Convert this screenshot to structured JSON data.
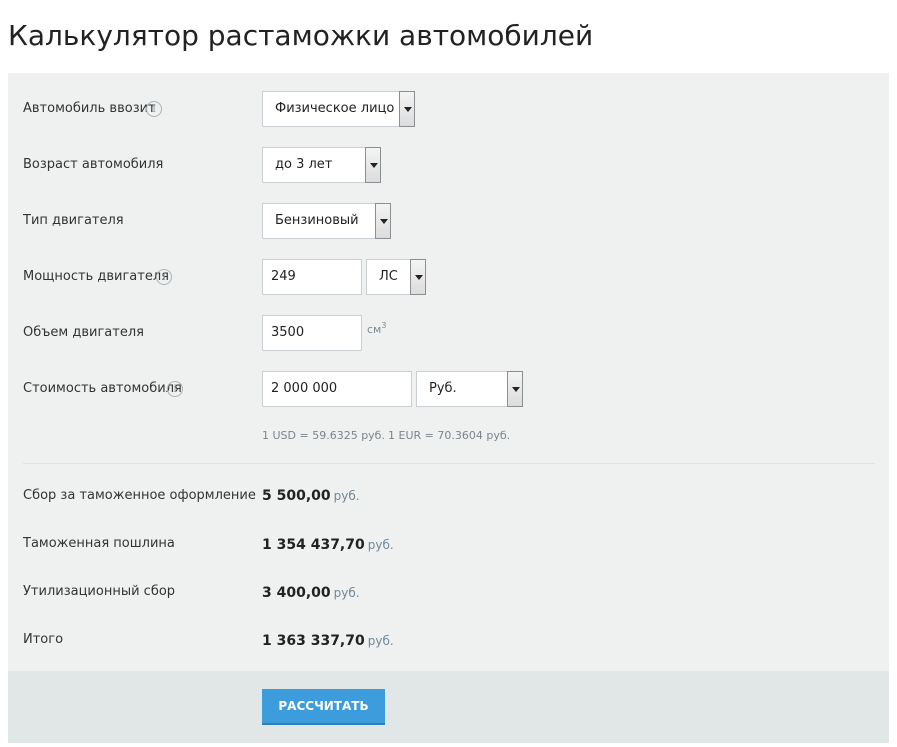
{
  "page": {
    "title": "Калькулятор растаможки автомобилей"
  },
  "form": {
    "importer": {
      "label": "Автомобиль ввозит",
      "value": "Физическое лицо"
    },
    "age": {
      "label": "Возраст автомобиля",
      "value": "до 3 лет"
    },
    "engine_type": {
      "label": "Тип двигателя",
      "value": "Бензиновый"
    },
    "power": {
      "label": "Мощность двигателя",
      "value": "249",
      "unit": "ЛС"
    },
    "volume": {
      "label": "Объем двигателя",
      "value": "3500",
      "unit": "см",
      "unit_exp": "3"
    },
    "cost": {
      "label": "Стоимость автомобиля",
      "value": "2 000 000",
      "currency": "Руб."
    },
    "info_glyph": "i"
  },
  "rates": {
    "usd": "1 USD = 59.6325 руб.",
    "eur": "1 EUR = 70.3604 руб."
  },
  "results": {
    "currency": "руб.",
    "items": [
      {
        "label": "Сбор за таможенное оформление",
        "value": "5 500,00"
      },
      {
        "label": "Таможенная пошлина",
        "value": "1 354 437,70"
      },
      {
        "label": "Утилизационный сбор",
        "value": "3 400,00"
      },
      {
        "label": "Итого",
        "value": "1 363 337,70"
      }
    ]
  },
  "actions": {
    "calculate_label": "РАССЧИТАТЬ"
  },
  "colors": {
    "panel_bg": "#eff1f1",
    "footer_bg": "#e1e6e7",
    "button_bg": "#3d9ddc",
    "unit_text": "#6f8898"
  },
  "icons": {
    "info": "info-icon",
    "dropdown": "chevron-down-icon"
  }
}
